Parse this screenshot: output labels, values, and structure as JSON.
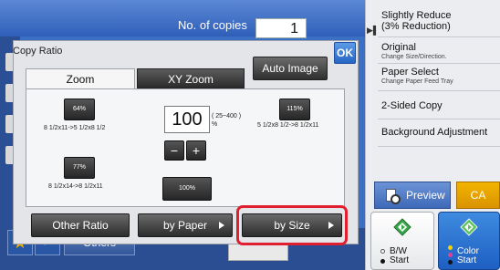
{
  "header": {
    "copies_label": "No. of copies",
    "copies_value": "1"
  },
  "right_panel": {
    "items": [
      {
        "label": "Slightly Reduce",
        "sub": "(3% Reduction)"
      },
      {
        "label": "Original",
        "sub": "Change Size/Direction."
      },
      {
        "label": "Paper Select",
        "sub": "Change Paper Feed Tray"
      },
      {
        "label": "2-Sided Copy",
        "sub": ""
      },
      {
        "label": "Background Adjustment",
        "sub": ""
      }
    ],
    "preview_label": "Preview",
    "ca_label": "CA",
    "bw_start": {
      "line1": "B/W",
      "line2": "Start"
    },
    "color_start": {
      "line1": "Color",
      "line2": "Start"
    }
  },
  "dialog": {
    "title": "Copy Ratio",
    "ok_label": "OK",
    "auto_image_label": "Auto Image",
    "tabs": {
      "zoom": "Zoom",
      "xy_zoom": "XY Zoom"
    },
    "presets": [
      {
        "value": "64%",
        "caption": "8 1/2x11->5 1/2x8 1/2"
      },
      {
        "value": "77%",
        "caption": "8 1/2x14->8 1/2x11"
      },
      {
        "value": "115%",
        "caption": "5 1/2x8 1/2->8 1/2x11"
      },
      {
        "value": "100%",
        "caption": ""
      }
    ],
    "ratio_value": "100",
    "range_text": "( 25~400 )",
    "range_unit": "%",
    "minus_label": "−",
    "plus_label": "+",
    "bottom_buttons": {
      "other_ratio": "Other Ratio",
      "by_paper": "by Paper",
      "by_size": "by Size"
    }
  },
  "bottom_bar": {
    "others_label": "Others",
    "star_icon": "★",
    "check_icon": "✓"
  },
  "colors": {
    "accent_highlight": "#e0202e",
    "ca_button": "#f2b400",
    "color_start": "#2a72d2"
  }
}
